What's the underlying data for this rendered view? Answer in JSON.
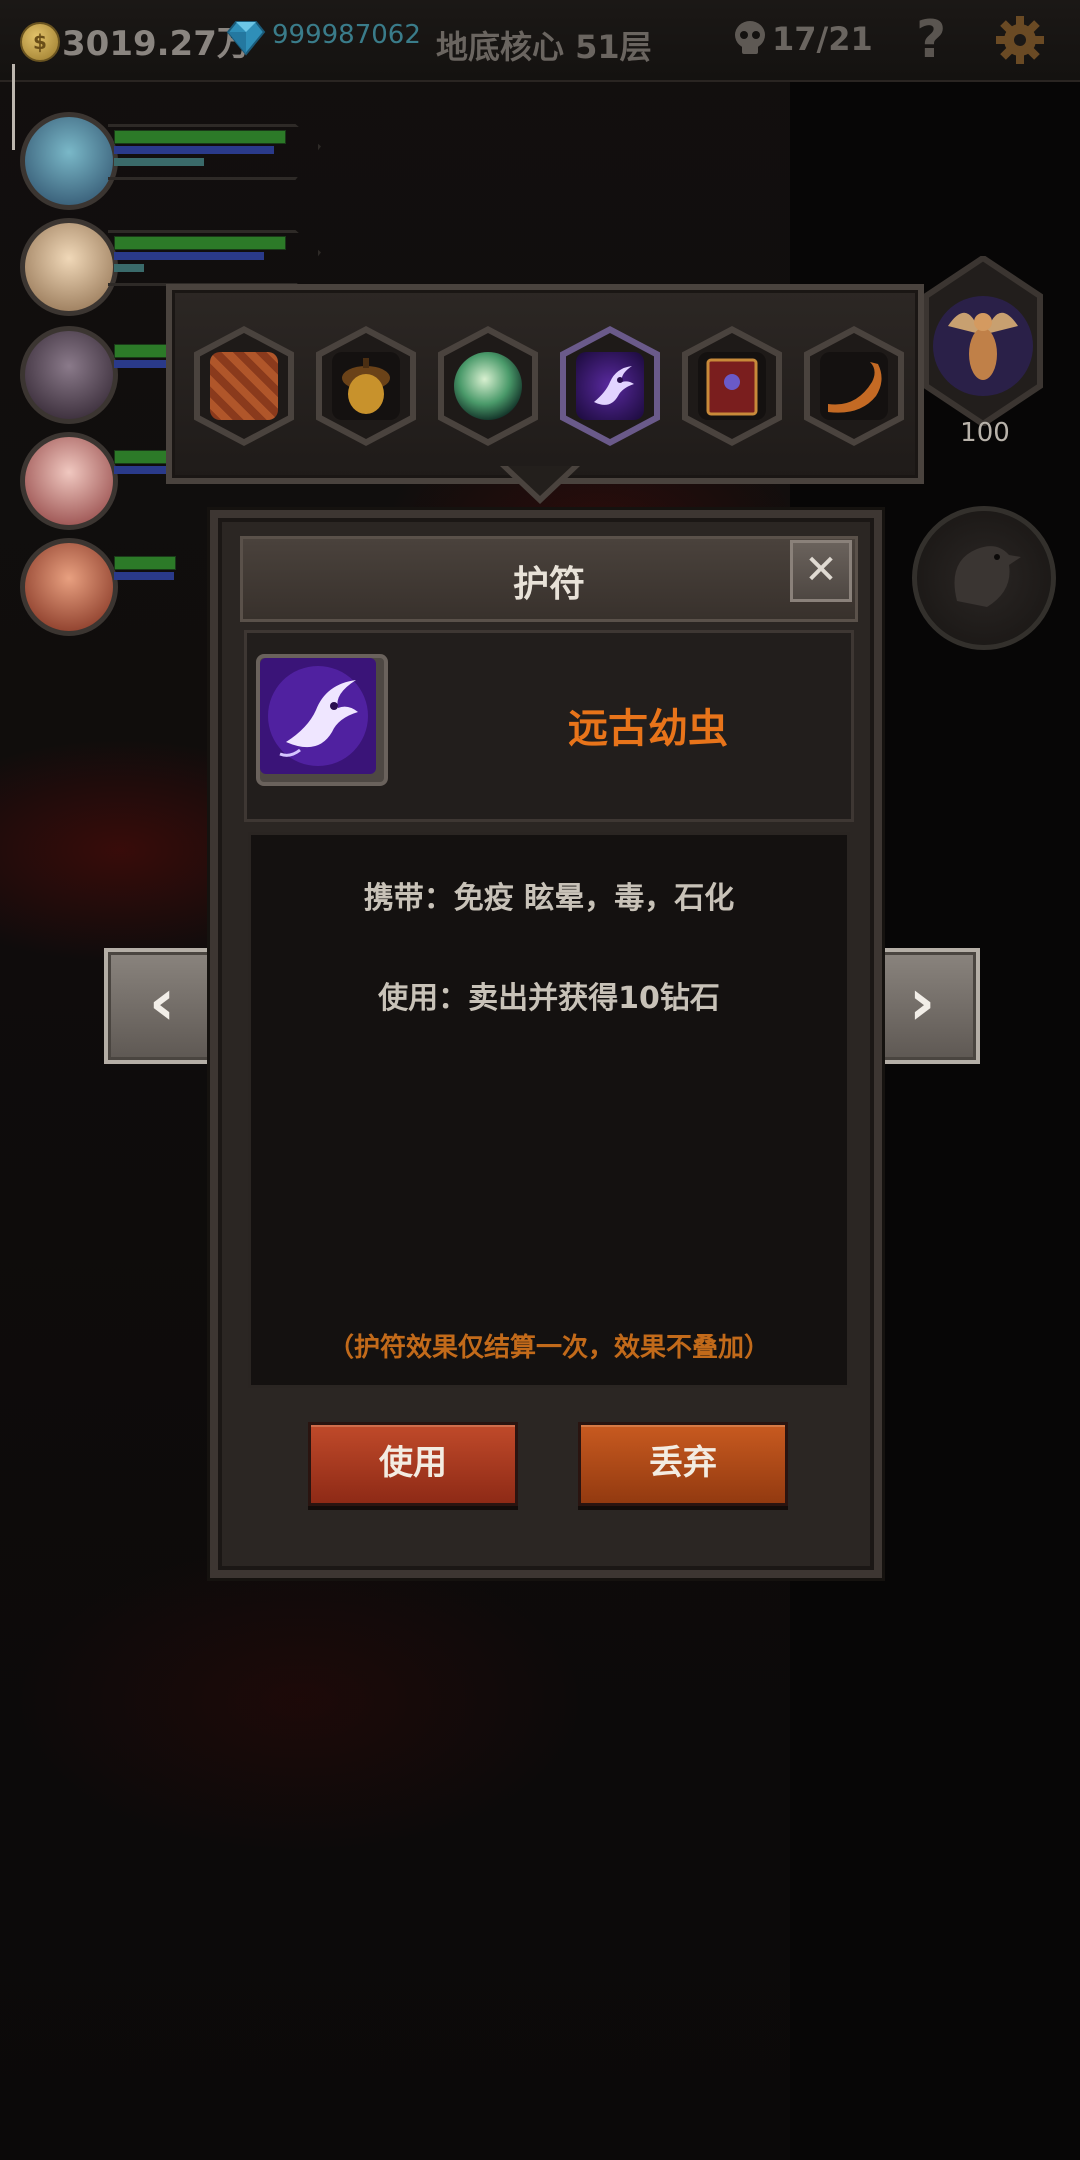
{
  "topbar": {
    "gold": "3019.27万",
    "diamonds": "999987062",
    "floor": "地底核心 51层",
    "kills": "17/21",
    "help_label": "?"
  },
  "angel_badge": {
    "count": "100"
  },
  "picker": {
    "items": [
      {
        "name": "scale-armor-item"
      },
      {
        "name": "acorn-item"
      },
      {
        "name": "green-orb-item"
      },
      {
        "name": "ancient-larva-item",
        "selected": true
      },
      {
        "name": "spellbook-item"
      },
      {
        "name": "horn-item"
      }
    ]
  },
  "dialog": {
    "title": "护符",
    "close_label": "✕",
    "item_name": "远古幼虫",
    "carry_effect": "携带：免疫 眩晕，毒，石化",
    "use_effect": "使用：卖出并获得10钻石",
    "note": "（护符效果仅结算一次，效果不叠加）",
    "use_button": "使用",
    "discard_button": "丢弃"
  },
  "nav": {
    "prev": "‹",
    "next": "›"
  },
  "colors": {
    "item_name": "#e8741a",
    "note": "#c26a1a",
    "use_button": "#b0402a",
    "discard_button": "#c05a20"
  }
}
